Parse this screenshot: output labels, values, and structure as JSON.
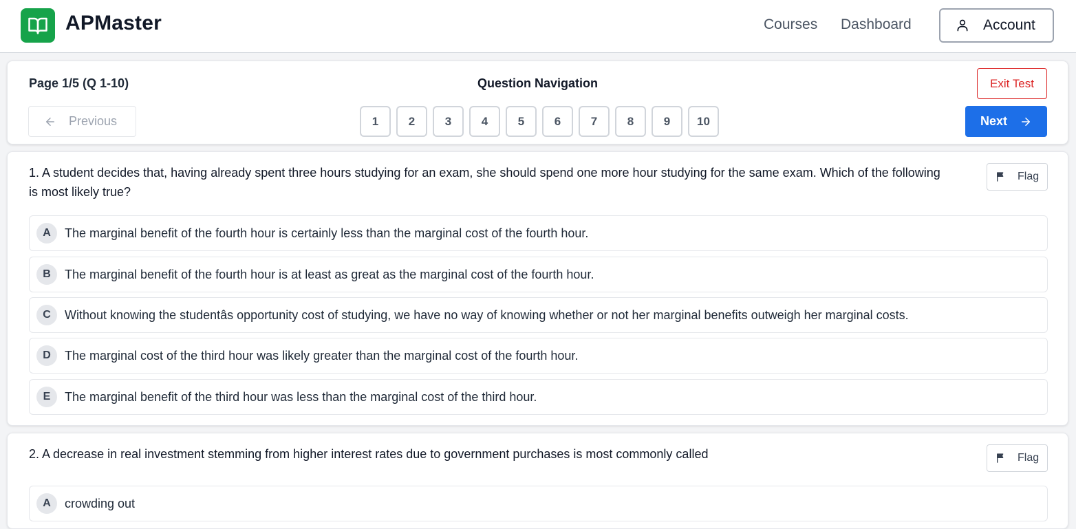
{
  "header": {
    "brand": "APMaster",
    "nav": [
      "Courses",
      "Dashboard"
    ],
    "account_label": "Account",
    "brand_color": "#16a34a"
  },
  "navigation": {
    "page_info": "Page 1/5 (Q 1-10)",
    "title": "Question Navigation",
    "exit_label": "Exit Test",
    "prev_label": "Previous",
    "next_label": "Next",
    "question_numbers": [
      "1",
      "2",
      "3",
      "4",
      "5",
      "6",
      "7",
      "8",
      "9",
      "10"
    ]
  },
  "questions": [
    {
      "text": "1. A student decides that, having already spent three hours studying for an exam, she should spend one more hour studying for the same exam. Which of the following is most likely true?",
      "flag_label": "Flag",
      "options": [
        {
          "letter": "A",
          "text": "The marginal benefit of the fourth hour is certainly less than the marginal cost of the fourth hour."
        },
        {
          "letter": "B",
          "text": "The marginal benefit of the fourth hour is at least as great as the marginal cost of the fourth hour."
        },
        {
          "letter": "C",
          "text": "Without knowing the studentâs opportunity cost of studying, we have no way of knowing whether or not her marginal benefits outweigh her marginal costs."
        },
        {
          "letter": "D",
          "text": "The marginal cost of the third hour was likely greater than the marginal cost of the fourth hour."
        },
        {
          "letter": "E",
          "text": "The marginal benefit of the third hour was less than the marginal cost of the third hour."
        }
      ]
    },
    {
      "text": "2. A decrease in real investment stemming from higher interest rates due to government purchases is most commonly called",
      "flag_label": "Flag",
      "options": [
        {
          "letter": "A",
          "text": "crowding out"
        }
      ]
    }
  ]
}
